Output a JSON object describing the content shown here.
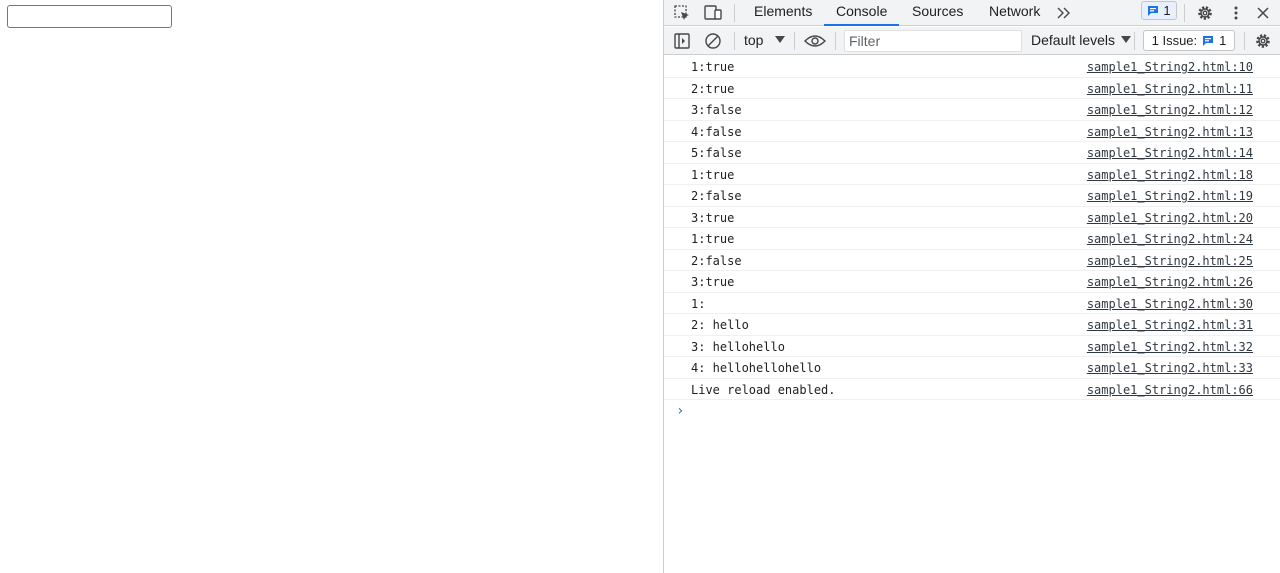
{
  "page": {
    "input_value": ""
  },
  "devtools": {
    "tabs": [
      {
        "label": "Elements",
        "active": false
      },
      {
        "label": "Console",
        "active": true
      },
      {
        "label": "Sources",
        "active": false
      },
      {
        "label": "Network",
        "active": false
      }
    ],
    "message_badge_count": "1",
    "toolbar": {
      "context": "top",
      "filter_placeholder": "Filter",
      "levels": "Default levels",
      "issues_label": "1 Issue:",
      "issues_count": "1"
    },
    "log": [
      {
        "message": "1:true",
        "source": "sample1_String2.html:10"
      },
      {
        "message": "2:true",
        "source": "sample1_String2.html:11"
      },
      {
        "message": "3:false",
        "source": "sample1_String2.html:12"
      },
      {
        "message": "4:false",
        "source": "sample1_String2.html:13"
      },
      {
        "message": "5:false",
        "source": "sample1_String2.html:14"
      },
      {
        "message": "1:true",
        "source": "sample1_String2.html:18"
      },
      {
        "message": "2:false",
        "source": "sample1_String2.html:19"
      },
      {
        "message": "3:true",
        "source": "sample1_String2.html:20"
      },
      {
        "message": "1:true",
        "source": "sample1_String2.html:24"
      },
      {
        "message": "2:false",
        "source": "sample1_String2.html:25"
      },
      {
        "message": "3:true",
        "source": "sample1_String2.html:26"
      },
      {
        "message": "1:",
        "source": "sample1_String2.html:30"
      },
      {
        "message": "2: hello",
        "source": "sample1_String2.html:31"
      },
      {
        "message": "3: hellohello",
        "source": "sample1_String2.html:32"
      },
      {
        "message": "4: hellohellohello",
        "source": "sample1_String2.html:33"
      },
      {
        "message": "Live reload enabled.",
        "source": "sample1_String2.html:66"
      }
    ],
    "prompt_symbol": "›"
  },
  "colors": {
    "accent": "#1a73e8",
    "toolbar_bg": "#f1f3f4",
    "border": "#cbcdd1"
  }
}
